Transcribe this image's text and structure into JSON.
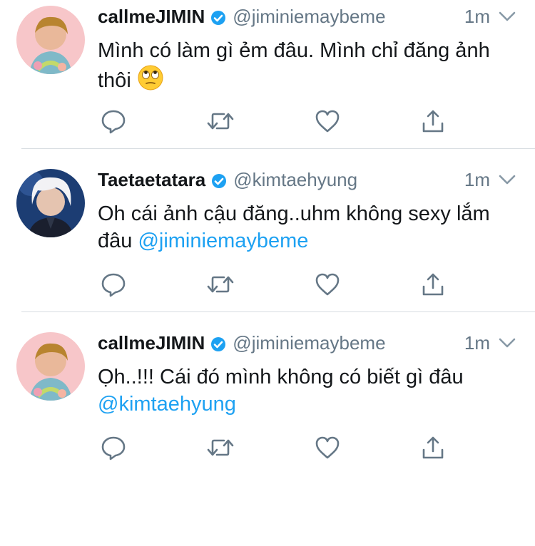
{
  "tweets": [
    {
      "name": "callmeJIMIN",
      "handle": "@jiminiemaybeme",
      "time": "1m",
      "text": "Mình có làm gì ẻm đâu. Mình chỉ đăng ảnh thôi",
      "mention": "",
      "emoji": "eye-roll-emoji"
    },
    {
      "name": "Taetaetatara",
      "handle": "@kimtaehyung",
      "time": "1m",
      "text": "Oh cái ảnh cậu đăng..uhm không sexy lắm đâu ",
      "mention": "@jiminiemaybeme"
    },
    {
      "name": "callmeJIMIN",
      "handle": "@jiminiemaybeme",
      "time": "1m",
      "text": "Ọh..!!! Cái đó mình không có biết gì đâu ",
      "mention": "@kimtaehyung"
    }
  ],
  "colors": {
    "text": "#14171a",
    "secondary": "#657786",
    "accent": "#1da1f2",
    "divider": "#d8dde1"
  },
  "icons": [
    "verified-badge-icon",
    "chevron-down-icon",
    "reply-icon",
    "retweet-icon",
    "like-icon",
    "share-icon"
  ]
}
